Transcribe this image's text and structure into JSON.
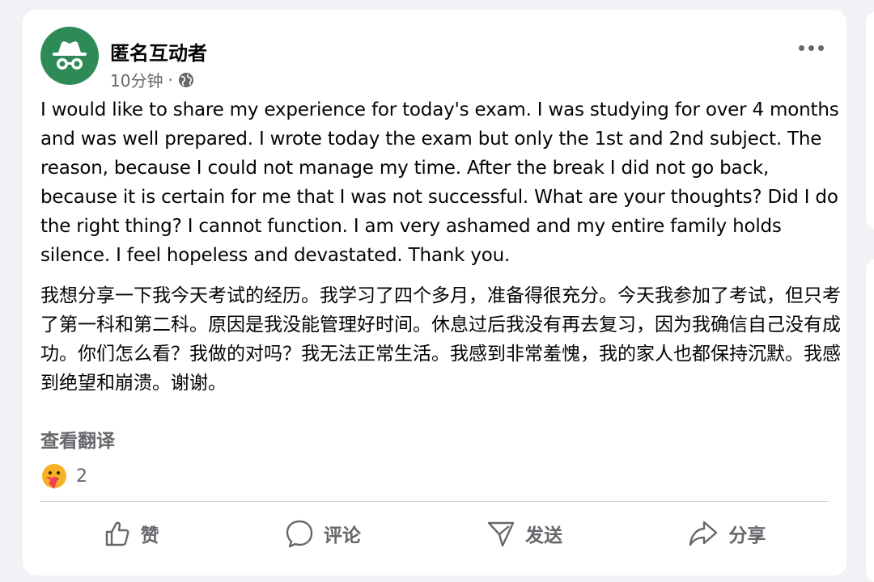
{
  "post": {
    "author": "匿名互动者",
    "time": "10分钟",
    "separator": "·",
    "privacy_icon": "globe-icon",
    "text_en": "I would like to share my experience for today's exam. I was studying for over 4 months and was well prepared. I wrote today the exam but only the 1st and 2nd subject. The reason, because I could not manage my time. After the break I did not go back, because it is certain for me that I was not successful. What are your thoughts? Did I do the right thing? I cannot function. I am very ashamed and my entire family holds silence. I feel hopeless and devastated. Thank you.",
    "text_zh": "我想分享一下我今天考试的经历。我学习了四个多月，准备得很充分。今天我参加了考试，但只考了第一科和第二科。原因是我没能管理好时间。休息过后我没有再去复习，因为我确信自己没有成功。你们怎么看？我做的对吗？我无法正常生活。我感到非常羞愧，我的家人也都保持沉默。我感到绝望和崩溃。谢谢。",
    "translate_label": "查看翻译",
    "reaction_icon": "care-reaction-icon",
    "reaction_count": "2"
  },
  "actions": {
    "like": "赞",
    "comment": "评论",
    "send": "发送",
    "share": "分享"
  },
  "colors": {
    "avatar_bg": "#2e8b57",
    "secondary_text": "#65676b",
    "page_bg": "#f0f2f5"
  }
}
